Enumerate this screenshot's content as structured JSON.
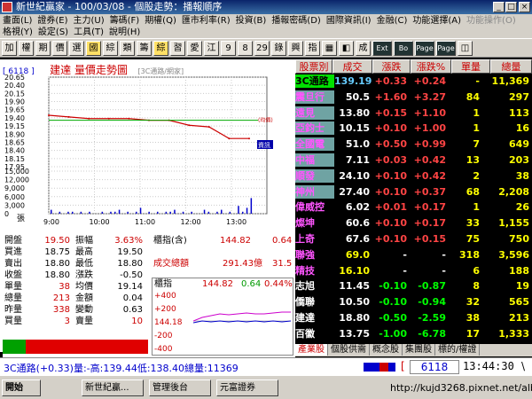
{
  "window": {
    "title": "新世紀贏家 - 100/03/08 - 個股走勢：播報順序",
    "min": "_",
    "max": "□",
    "close": "×"
  },
  "menu1": [
    "畫面(L)",
    "證券(E)",
    "主力(U)",
    "籌碼(F)",
    "期權(Q)",
    "匯市利率(R)",
    "投資(B)",
    "播報密碼(D)",
    "國際資訊(I)",
    "金融(C)",
    "功能選擇(A)"
  ],
  "menu1_dim": "功能操作(O)",
  "menu2": [
    "格視(Y)",
    "設定(S)",
    "工具(T)",
    "說明(H)"
  ],
  "toolbar": [
    "加",
    "權",
    "期",
    "價",
    "選",
    "國",
    "綜",
    "類",
    "籌",
    "綜",
    "習",
    "愛",
    "江",
    "9",
    "8",
    "29",
    "錄",
    "興",
    "指",
    "▦",
    "◧",
    "成",
    "Ext",
    "Bo",
    "Page",
    "Page",
    "◫"
  ],
  "chart": {
    "code": "[ 6118 ]",
    "title": "建達  量價走勢圖",
    "subtitle": "[3C通路/網家]",
    "yprice": [
      "20.65",
      "20.40",
      "20.15",
      "19.90",
      "19.65",
      "19.40",
      "19.15",
      "18.90",
      "18.65",
      "18.40",
      "18.15",
      "17.95"
    ],
    "yvol": [
      "15,000",
      "12,000",
      "9,000",
      "6,000",
      "3,000",
      "0"
    ],
    "vol_unit": "張",
    "xticks": [
      "9:00",
      "10:00",
      "11:00",
      "12:00",
      "13:00"
    ],
    "avg_tag": "(均價)",
    "info_tag": "資訊",
    "line_color": "#cc0000",
    "avg_color": "#00aa00"
  },
  "chart_data": {
    "type": "line",
    "x": [
      "9:00",
      "9:30",
      "10:00",
      "10:30",
      "11:00",
      "11:30",
      "12:00",
      "12:30",
      "13:00",
      "13:20",
      "13:30"
    ],
    "series": [
      {
        "values": [
          19.5,
          19.45,
          19.4,
          19.4,
          19.4,
          19.35,
          19.35,
          19.2,
          19.15,
          18.8,
          18.8
        ]
      }
    ],
    "ylim": [
      17.95,
      20.65
    ]
  },
  "stats": {
    "rows": [
      {
        "l": "開盤",
        "v": "19.50",
        "l2": "振幅",
        "v2": "3.63%",
        "c": "#c00",
        "c2": "#c00"
      },
      {
        "l": "買進",
        "v": "18.75",
        "l2": "最高",
        "v2": "19.50",
        "c": "#000",
        "c2": "#000"
      },
      {
        "l": "賣出",
        "v": "18.80",
        "l2": "最低",
        "v2": "18.80",
        "c": "#000",
        "c2": "#000"
      },
      {
        "l": "收盤",
        "v": "18.80",
        "l2": "漲跌",
        "v2": "-0.50",
        "c": "#000",
        "c2": "#000"
      },
      {
        "l": "單量",
        "v": "38",
        "l2": "均價",
        "v2": "19.14",
        "c": "#c00",
        "c2": "#000"
      },
      {
        "l": "總量",
        "v": "213",
        "l2": "金額",
        "v2": "0.04",
        "c": "#c00",
        "c2": "#000"
      },
      {
        "l": "昨量",
        "v": "338",
        "l2": "變動",
        "v2": "0.63",
        "c": "#c00",
        "c2": "#000"
      },
      {
        "l": "買量",
        "v": "3",
        "l2": "賣量",
        "v2": "10",
        "c": "#c00",
        "c2": "#c00"
      }
    ],
    "index_label": "櫃指(含)",
    "index_value": "144.82",
    "index_change": "0.64",
    "turnover_label": "成交總額",
    "turnover_value": "291.43億",
    "turnover_change": "31.5"
  },
  "mini": {
    "label": "櫃指",
    "value": "144.82",
    "change": "0.64",
    "pct": "0.44%",
    "yl": [
      "+400",
      "+200",
      "144.18",
      "-200",
      "-400"
    ]
  },
  "table": {
    "headers": [
      "股票別",
      "成交",
      "漲跌",
      "漲跌%",
      "單量",
      "總量"
    ],
    "rows": [
      {
        "name": "3C通路",
        "price": "139.19",
        "chg": "+0.33",
        "pct": "+0.24",
        "vol": "-",
        "total": "11,369",
        "nc": "#000",
        "nbg": "#00e000",
        "cc": "#66ccff"
      },
      {
        "name": "震旦行",
        "price": "50.5",
        "chg": "+1.60",
        "pct": "+3.27",
        "vol": "84",
        "total": "297",
        "nc": "#ff55ff",
        "nbg": "#6fa3a3",
        "cc": "#fff"
      },
      {
        "name": "遠見",
        "price": "13.80",
        "chg": "+0.15",
        "pct": "+1.10",
        "vol": "1",
        "total": "113",
        "nc": "#ff55ff",
        "nbg": "#6fa3a3",
        "cc": "#fff"
      },
      {
        "name": "亞鈞士",
        "price": "10.15",
        "chg": "+0.10",
        "pct": "+1.00",
        "vol": "1",
        "total": "16",
        "nc": "#ff55ff",
        "nbg": "#6fa3a3",
        "cc": "#fff"
      },
      {
        "name": "全國電",
        "price": "51.0",
        "chg": "+0.50",
        "pct": "+0.99",
        "vol": "7",
        "total": "649",
        "nc": "#ff55ff",
        "nbg": "#6fa3a3",
        "cc": "#fff"
      },
      {
        "name": "中福",
        "price": "7.11",
        "chg": "+0.03",
        "pct": "+0.42",
        "vol": "13",
        "total": "203",
        "nc": "#ff55ff",
        "nbg": "#6fa3a3",
        "cc": "#fff"
      },
      {
        "name": "順發",
        "price": "24.10",
        "chg": "+0.10",
        "pct": "+0.42",
        "vol": "2",
        "total": "38",
        "nc": "#ff55ff",
        "nbg": "#6fa3a3",
        "cc": "#fff"
      },
      {
        "name": "神州",
        "price": "27.40",
        "chg": "+0.10",
        "pct": "+0.37",
        "vol": "68",
        "total": "2,208",
        "nc": "#ff55ff",
        "nbg": "#6fa3a3",
        "cc": "#fff"
      },
      {
        "name": "偉威控",
        "price": "6.02",
        "chg": "+0.01",
        "pct": "+0.17",
        "vol": "1",
        "total": "26",
        "nc": "#ff55ff",
        "nbg": "#000",
        "cc": "#fff"
      },
      {
        "name": "燦坤",
        "price": "60.6",
        "chg": "+0.10",
        "pct": "+0.17",
        "vol": "33",
        "total": "1,155",
        "nc": "#ff55ff",
        "nbg": "#000",
        "cc": "#fff"
      },
      {
        "name": "上奇",
        "price": "67.6",
        "chg": "+0.10",
        "pct": "+0.15",
        "vol": "75",
        "total": "750",
        "nc": "#ff55ff",
        "nbg": "#000",
        "cc": "#fff"
      },
      {
        "name": "聯強",
        "price": "69.0",
        "chg": "-",
        "pct": "-",
        "vol": "318",
        "total": "3,596",
        "nc": "#ff55ff",
        "nbg": "#000",
        "cc": "#ffff00"
      },
      {
        "name": "精技",
        "price": "16.10",
        "chg": "-",
        "pct": "-",
        "vol": "6",
        "total": "188",
        "nc": "#ff55ff",
        "nbg": "#000",
        "cc": "#ffff00"
      },
      {
        "name": "志旭",
        "price": "11.45",
        "chg": "-0.10",
        "pct": "-0.87",
        "vol": "8",
        "total": "19",
        "nc": "#fff",
        "nbg": "#000",
        "cc": "#fff"
      },
      {
        "name": "僑聯",
        "price": "10.50",
        "chg": "-0.10",
        "pct": "-0.94",
        "vol": "32",
        "total": "565",
        "nc": "#fff",
        "nbg": "#000",
        "cc": "#fff"
      },
      {
        "name": "建達",
        "price": "18.80",
        "chg": "-0.50",
        "pct": "-2.59",
        "vol": "38",
        "total": "213",
        "nc": "#fff",
        "nbg": "#000",
        "cc": "#fff"
      },
      {
        "name": "百徽",
        "price": "13.75",
        "chg": "-1.00",
        "pct": "-6.78",
        "vol": "17",
        "total": "1,333",
        "nc": "#fff",
        "nbg": "#000",
        "cc": "#fff"
      }
    ],
    "tabs": [
      "產業股",
      "個股供需",
      "概念股",
      "集團股",
      "標的/權證"
    ]
  },
  "status": {
    "text": "3C通路(+0.33)量:-高:139.44低:138.40總量:11369",
    "code": "6118",
    "time": "13:44:30"
  },
  "taskbar": {
    "start": "開始",
    "items": [
      "新世紀贏...",
      "管理後台",
      "元富證券"
    ],
    "url": "http://kujd3268.pixnet.net/album"
  }
}
